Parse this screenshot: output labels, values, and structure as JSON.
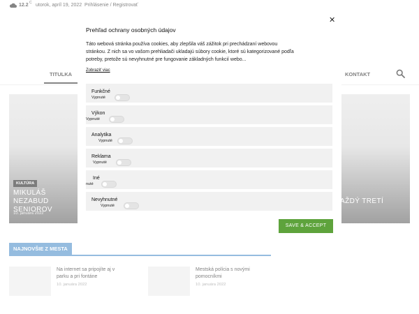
{
  "topbar": {
    "weather_icon": "cloud-icon",
    "temperature": "12.2",
    "temp_unit": "C",
    "date": "utorok, apríl 19, 2022",
    "login_link": "Prihlásenie / Registrovať"
  },
  "nav": {
    "left_item": "TITULKA",
    "right_item": "KONTAKT",
    "search_icon": "search-icon"
  },
  "hero_left": {
    "badge": "KULTÚRA",
    "title_line1": "MIKULÁŠ NEZABUD",
    "title_line2": "SENIOROV",
    "date": "10. januára 2022"
  },
  "hero_right": {
    "title": "AŽDÝ TRETÍ"
  },
  "section": {
    "heading": "NAJNOVŠIE Z MESTA"
  },
  "articles": [
    {
      "title_line1": "Na internet sa pripojíte aj v",
      "title_line2": "parku a pri fontáne",
      "date": "10. januára 2022"
    },
    {
      "title_line1": "Mestská polícia s novými",
      "title_line2": "pomocníkmi",
      "date": "10. januára 2022"
    }
  ],
  "modal": {
    "title": "Prehľad ochrany osobných údajov",
    "close": "✕",
    "desc_line1": "Táto webová stránka používa cookies, aby zlepšila váš zážitok pri prechádzaní webovou",
    "desc_line2": "stránkou. Z nich sa vo vašom prehliadači ukladajú súbory cookie, ktoré sú kategorizované podľa",
    "desc_line3": "potreby, pretože sú nevyhnutné pre fungovanie základných funkcií webo...",
    "more": "Zobraziť viac",
    "categories": [
      {
        "label": "Funkčné",
        "state": "Vypnuté"
      },
      {
        "label": "Výkon",
        "state": "Vypnuté"
      },
      {
        "label": "Analytika",
        "state": "Vypnuté"
      },
      {
        "label": "Reklama",
        "state": "Vypnuté"
      },
      {
        "label": "Iné",
        "state": "nuté"
      },
      {
        "label": "Nevyhnutné",
        "state": "Vypnuté"
      }
    ],
    "accept": "SAVE & ACCEPT"
  },
  "colors": {
    "accent_blue": "#3e86c5",
    "accept_green": "#5ea33c"
  }
}
